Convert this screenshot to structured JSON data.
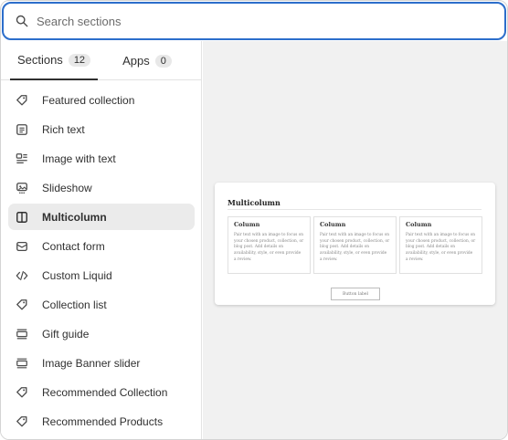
{
  "search": {
    "placeholder": "Search sections"
  },
  "tabs": [
    {
      "label": "Sections",
      "count": "12",
      "active": true
    },
    {
      "label": "Apps",
      "count": "0",
      "active": false
    }
  ],
  "sections": [
    {
      "label": "Featured collection",
      "icon": "tag-icon"
    },
    {
      "label": "Rich text",
      "icon": "text-block-icon"
    },
    {
      "label": "Image with text",
      "icon": "image-with-text-icon"
    },
    {
      "label": "Slideshow",
      "icon": "slideshow-icon"
    },
    {
      "label": "Multicolumn",
      "icon": "columns-icon",
      "selected": true
    },
    {
      "label": "Contact form",
      "icon": "envelope-icon"
    },
    {
      "label": "Custom Liquid",
      "icon": "code-icon"
    },
    {
      "label": "Collection list",
      "icon": "tag-icon"
    },
    {
      "label": "Gift guide",
      "icon": "list-layout-icon"
    },
    {
      "label": "Image Banner slider",
      "icon": "list-layout-icon"
    },
    {
      "label": "Recommended Collection",
      "icon": "tag-icon"
    },
    {
      "label": "Recommended Products",
      "icon": "tag-icon"
    }
  ],
  "preview": {
    "title": "Multicolumn",
    "columns": [
      {
        "heading": "Column",
        "text": "Pair text with an image to focus on your chosen product, collection, or blog post. Add details on availability, style, or even provide a review."
      },
      {
        "heading": "Column",
        "text": "Pair text with an image to focus on your chosen product, collection, or blog post. Add details on availability, style, or even provide a review."
      },
      {
        "heading": "Column",
        "text": "Pair text with an image to focus on your chosen product, collection, or blog post. Add details on availability, style, or even provide a review."
      }
    ],
    "button_label": "Button label"
  },
  "colors": {
    "accent": "#2c6ecb",
    "selected_bg": "#ebebeb",
    "preview_bg": "#f1f1f1"
  }
}
